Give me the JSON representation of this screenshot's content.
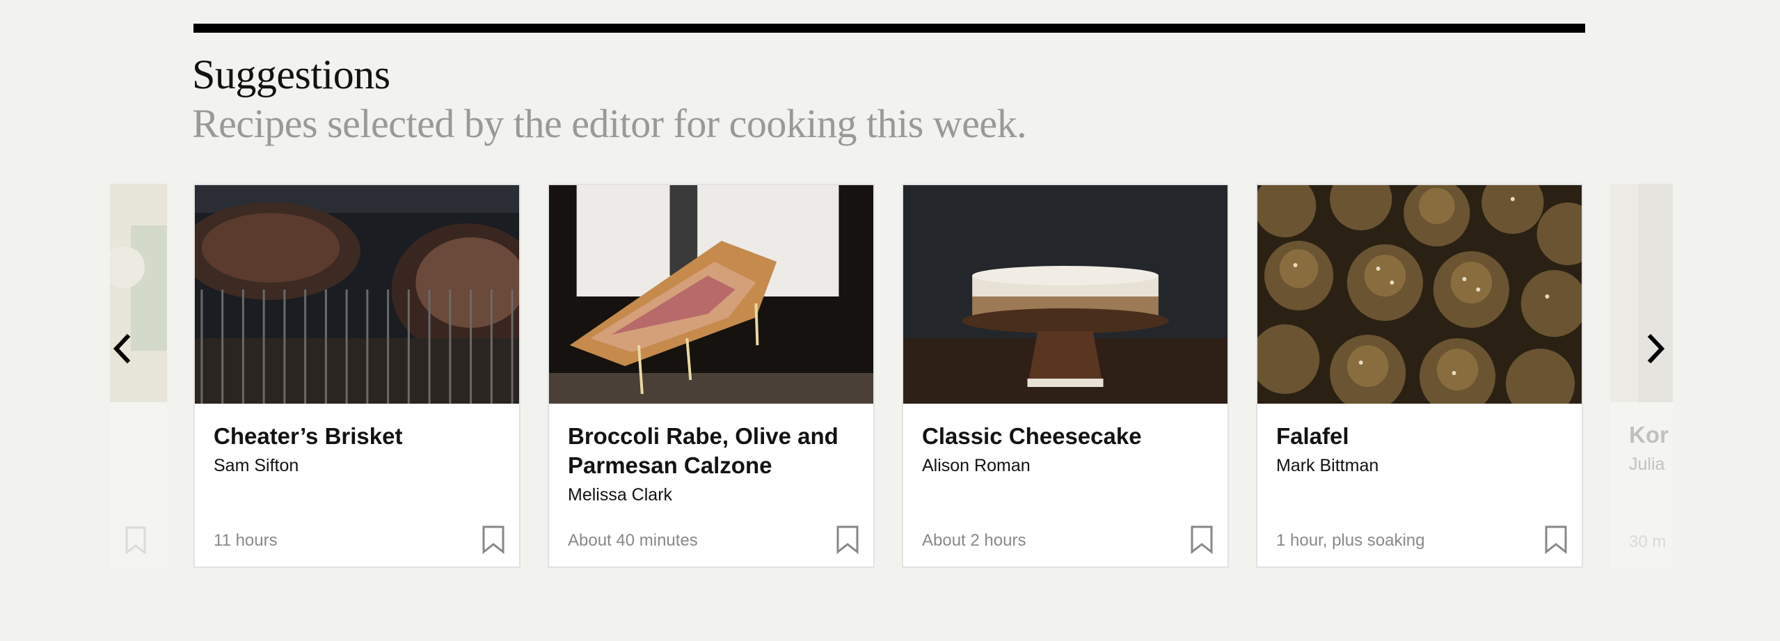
{
  "header": {
    "title": "Suggestions",
    "subtitle": "Recipes selected by the editor for cooking this week."
  },
  "carousel": {
    "prev_icon": "chevron-left-icon",
    "next_icon": "chevron-right-icon",
    "cards": [
      {
        "name": "Cheater’s Brisket",
        "author": "Sam Sifton",
        "time": "11 hours",
        "image": "grilled-brisket"
      },
      {
        "name": "Broccoli Rabe, Olive and Parmesan Calzone",
        "author": "Melissa Clark",
        "time": "About 40 minutes",
        "image": "calzone"
      },
      {
        "name": "Classic Cheesecake",
        "author": "Alison Roman",
        "time": "About 2 hours",
        "image": "cheesecake"
      },
      {
        "name": "Falafel",
        "author": "Mark Bittman",
        "time": "1 hour, plus soaking",
        "image": "falafel"
      }
    ],
    "partial_right": {
      "name": "Kor",
      "author": "Julia",
      "time": "30 m"
    }
  },
  "colors": {
    "background": "#f2f2ee",
    "text": "#121212",
    "muted": "#999999",
    "divider": "#000000"
  }
}
